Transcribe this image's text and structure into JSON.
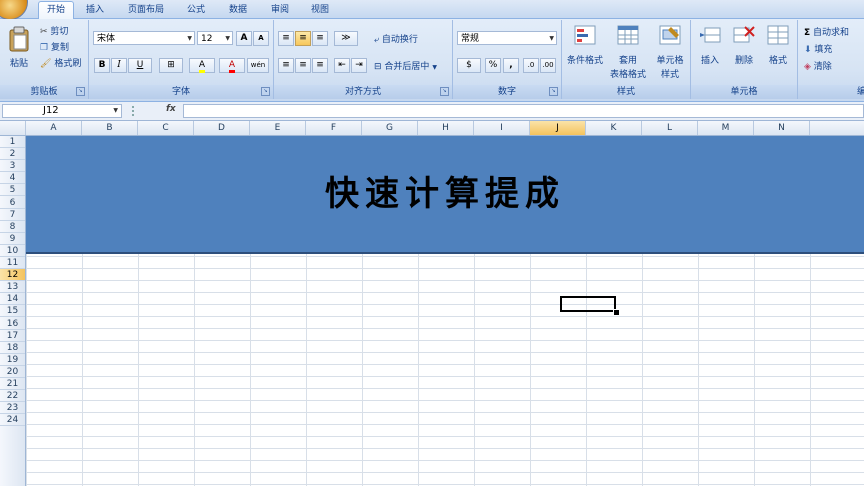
{
  "tabs": [
    "开始",
    "插入",
    "页面布局",
    "公式",
    "数据",
    "审阅",
    "视图"
  ],
  "clipboard": {
    "paste": "粘贴",
    "cut": "剪切",
    "copy": "复制",
    "painter": "格式刷",
    "label": "剪贴板"
  },
  "font": {
    "name": "宋体",
    "size": "12",
    "grow": "A",
    "shrink": "A",
    "bold": "B",
    "italic": "I",
    "underline": "U",
    "fill_letter": "A",
    "color_letter": "A",
    "phonetic": "wén",
    "label": "字体"
  },
  "alignment": {
    "wrap": "自动换行",
    "merge": "合并后居中",
    "label": "对齐方式"
  },
  "number": {
    "format": "常规",
    "percent": "%",
    "comma": ",",
    "label": "数字"
  },
  "styles": {
    "conditional": "条件格式",
    "table_line1": "套用",
    "table_line2": "表格格式",
    "cell_line1": "单元格",
    "cell_line2": "样式",
    "label": "样式"
  },
  "cells": {
    "insert": "插入",
    "delete": "删除",
    "format": "格式",
    "label": "单元格"
  },
  "editing": {
    "autosum": "自动求和",
    "fill": "填充",
    "clear": "清除",
    "label": "编"
  },
  "formula_bar": {
    "name_box": "J12",
    "fx": "fx",
    "content": ""
  },
  "columns": [
    "A",
    "B",
    "C",
    "D",
    "E",
    "F",
    "G",
    "H",
    "I",
    "J",
    "K",
    "L",
    "M",
    "N"
  ],
  "rows": [
    "1",
    "2",
    "3",
    "4",
    "5",
    "6",
    "7",
    "8",
    "9",
    "10",
    "11",
    "12",
    "13",
    "14",
    "15",
    "16",
    "17",
    "18",
    "19",
    "20",
    "21",
    "22",
    "23",
    "24"
  ],
  "selected_column": "J",
  "selected_row": "12",
  "sheet": {
    "title": "快速计算提成",
    "banner_color": "#4f81bd"
  }
}
